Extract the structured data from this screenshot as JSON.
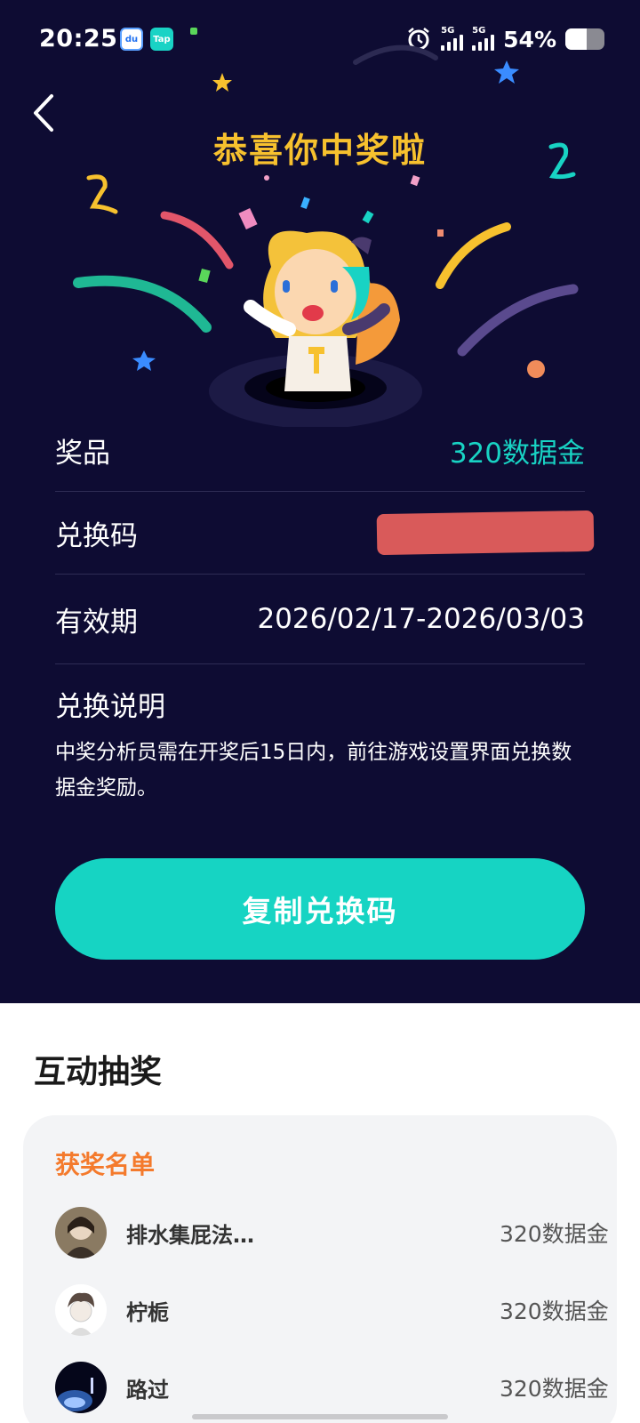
{
  "status_bar": {
    "time": "20:25",
    "badge_du": "du",
    "badge_tap": "Tap",
    "sim1": "5G",
    "sim2": "5G",
    "battery_text": "54%",
    "battery_level": 0.54
  },
  "header": {
    "title": "恭喜你中奖啦"
  },
  "prize_info": {
    "prize_label": "奖品",
    "prize_value": "320数据金",
    "code_label": "兑换码",
    "validity_label": "有效期",
    "validity_value": "2026/02/17-2026/03/03",
    "desc_title": "兑换说明",
    "desc_text": "中奖分析员需在开奖后15日内，前往游戏设置界面兑换数据金奖励。"
  },
  "copy_button": {
    "label": "复制兑换码"
  },
  "lottery": {
    "section_title": "互动抽奖",
    "winners_title": "获奖名单",
    "winners": [
      {
        "name": "排水集屁法…",
        "prize": "320数据金"
      },
      {
        "name": "柠栀",
        "prize": "320数据金"
      },
      {
        "name": "路过",
        "prize": "320数据金"
      }
    ]
  },
  "colors": {
    "background_dark": "#0e0c33",
    "accent_teal": "#16d4c3",
    "title_gold": "#f7c12e",
    "winners_orange": "#f47a2c"
  }
}
